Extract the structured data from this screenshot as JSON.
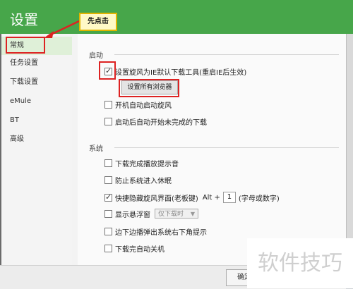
{
  "window": {
    "title": "设置"
  },
  "callout": {
    "text": "先点击"
  },
  "sidebar": {
    "items": [
      {
        "label": "常规"
      },
      {
        "label": "任务设置"
      },
      {
        "label": "下载设置"
      },
      {
        "label": "eMule"
      },
      {
        "label": "BT"
      },
      {
        "label": "高级"
      }
    ]
  },
  "startup": {
    "section_title": "启动",
    "items": [
      {
        "label": "设置旋风为IE默认下载工具(重启IE后生效)",
        "checked": true
      },
      {
        "label": "开机自动启动旋风",
        "checked": false
      },
      {
        "label": "启动后自动开始未完成的下载",
        "checked": false
      }
    ],
    "browsers_button": "设置所有浏览器"
  },
  "system": {
    "section_title": "系统",
    "items": [
      {
        "label": "下载完成播放提示音",
        "checked": false
      },
      {
        "label": "防止系统进入休眠",
        "checked": false
      },
      {
        "label": "快捷隐藏旋风界面(老板键)",
        "checked": true
      },
      {
        "label": "显示悬浮窗",
        "checked": false
      },
      {
        "label": "边下边播弹出系统右下角提示",
        "checked": false
      },
      {
        "label": "下载完自动关机",
        "checked": false
      }
    ],
    "hotkey_prefix": "Alt +",
    "hotkey_value": "1",
    "hotkey_hint": "(字母或数字)",
    "float_option": "仅下载时"
  },
  "footer": {
    "ok_label": "确定"
  },
  "watermark": {
    "text": "软件技巧"
  },
  "colors": {
    "titlebar": "#47a64a",
    "annotation": "#d22222",
    "callout_bg": "#fff9c7"
  }
}
